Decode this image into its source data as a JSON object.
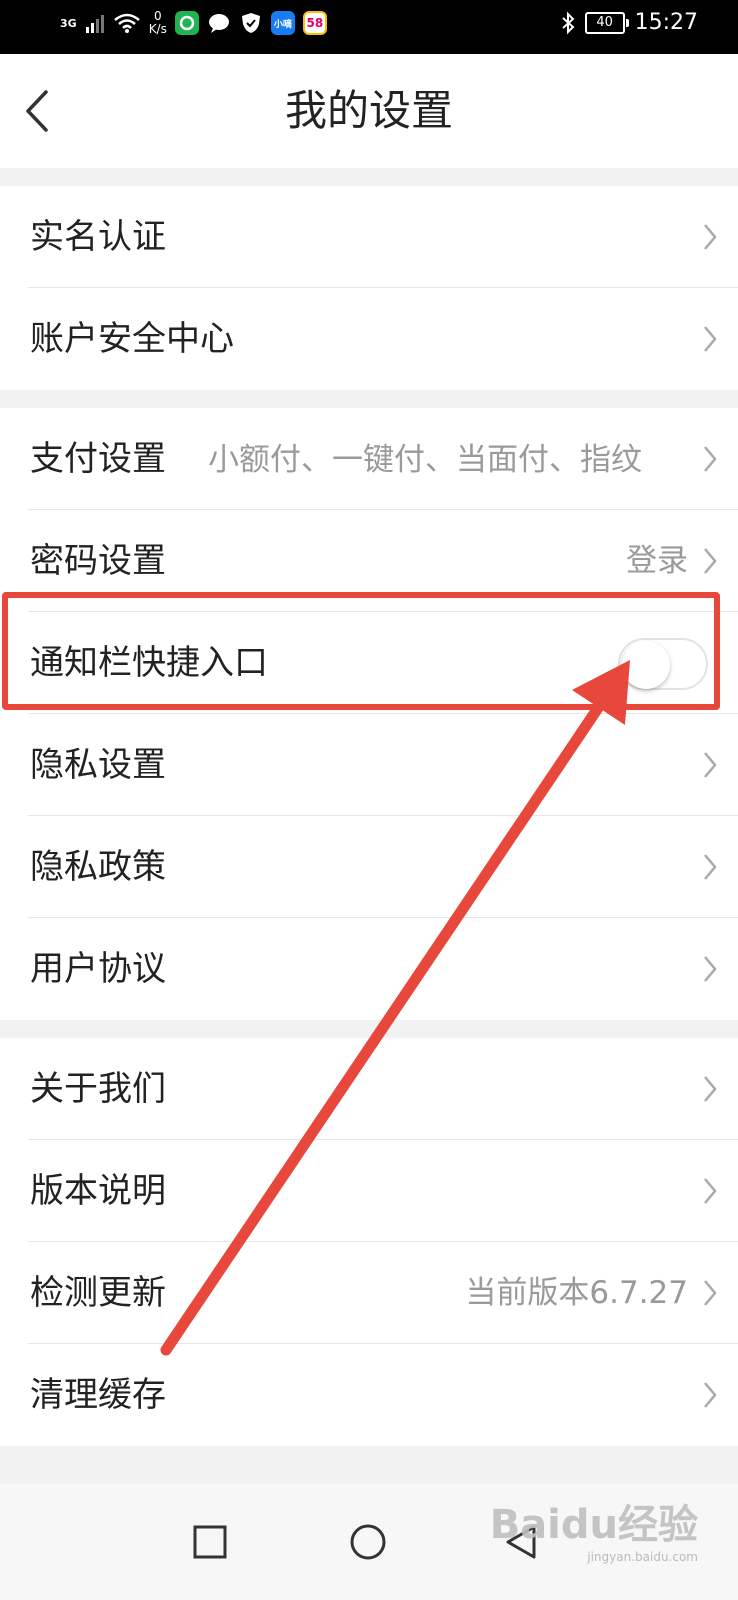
{
  "status_bar": {
    "network": "3G",
    "speed_value": "0",
    "speed_unit": "K/s",
    "app_icons": [
      {
        "name": "green-app",
        "text": "",
        "color": "#21b352"
      },
      {
        "name": "chat-app",
        "text": "",
        "color": "#000000"
      },
      {
        "name": "shield-app",
        "text": "",
        "color": "#000000"
      },
      {
        "name": "xiaomi-app",
        "text": "小嘀",
        "color": "#1a7cf5"
      },
      {
        "name": "58-app",
        "text": "58",
        "color": "#f8c000"
      }
    ],
    "battery": "40",
    "time": "15:27"
  },
  "header": {
    "title": "我的设置"
  },
  "groups": [
    {
      "rows": [
        {
          "label": "实名认证",
          "value": "",
          "type": "link"
        },
        {
          "label": "账户安全中心",
          "value": "",
          "type": "link"
        }
      ]
    },
    {
      "rows": [
        {
          "label": "支付设置",
          "value": "小额付、一键付、当面付、指纹",
          "type": "link"
        },
        {
          "label": "密码设置",
          "value": "登录",
          "type": "link"
        },
        {
          "label": "通知栏快捷入口",
          "value": "",
          "type": "toggle",
          "on": false
        },
        {
          "label": "隐私设置",
          "value": "",
          "type": "link"
        },
        {
          "label": "隐私政策",
          "value": "",
          "type": "link"
        },
        {
          "label": "用户协议",
          "value": "",
          "type": "link"
        }
      ]
    },
    {
      "rows": [
        {
          "label": "关于我们",
          "value": "",
          "type": "link"
        },
        {
          "label": "版本说明",
          "value": "",
          "type": "link"
        },
        {
          "label": "检测更新",
          "value": "当前版本6.7.27",
          "type": "link"
        },
        {
          "label": "清理缓存",
          "value": "",
          "type": "link"
        }
      ]
    }
  ],
  "annotation": {
    "color": "#e8473b"
  },
  "watermark": {
    "text": "Baidu经验",
    "sub": "jingyan.baidu.com"
  }
}
